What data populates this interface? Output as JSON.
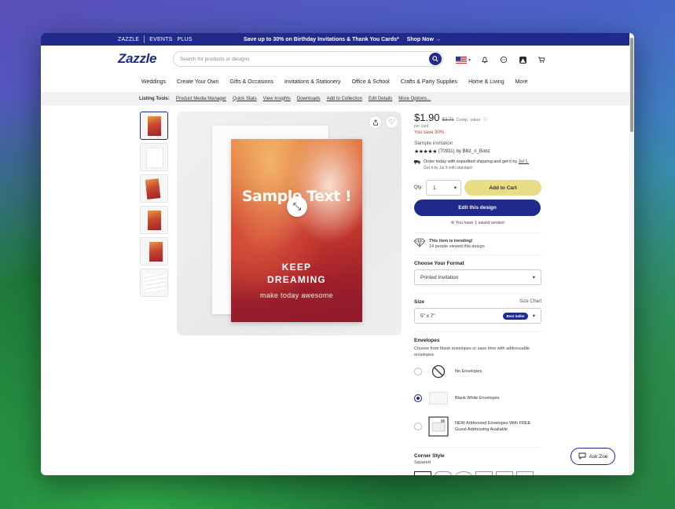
{
  "promo": {
    "links": [
      "ZAZZLE",
      "EVENTS",
      "PLUS"
    ],
    "message": "Save up to 30% on Birthday Invitations & Thank You Cards*",
    "cta": "Shop Now →"
  },
  "header": {
    "logo": "Zazzle",
    "search_placeholder": "Search for products or designs"
  },
  "nav": [
    "Weddings",
    "Create Your Own",
    "Gifts & Occasions",
    "Invitations & Stationery",
    "Office & School",
    "Crafts & Party Supplies",
    "Home & Living",
    "More"
  ],
  "tools": {
    "label": "Listing Tools:",
    "links": [
      "Product Media Manager",
      "Quick Stats",
      "View Insights",
      "Downloads",
      "Add to Collection",
      "Edit Details",
      "More Options..."
    ]
  },
  "card": {
    "title": "Sample Text !",
    "line1": "KEEP",
    "line2": "DREAMING",
    "line3": "make today awesome"
  },
  "product": {
    "price": "$1.90",
    "comp_price": "$2.71",
    "comp_label": "Comp. value",
    "per": "per card",
    "save": "You save 30%",
    "name": "Sample invitation",
    "stars": "★★★★★",
    "reviews": "(70931)",
    "by": "by Blitz_n_Bobz",
    "ship_line1": "Order today with expedited shipping and get it by",
    "ship_date": "Jul 1.",
    "ship_line2": "Get it by Jul 9 with standard",
    "qty_label": "Qty:",
    "qty": "1",
    "add_to_cart": "Add to Cart",
    "edit": "Edit this design",
    "saved": "You have 1 saved version",
    "trend_title": "This item is trending!",
    "trend_sub": "14 people viewed this design"
  },
  "options": {
    "format_title": "Choose Your Format",
    "format_value": "Printed Invitation",
    "size_title": "Size",
    "size_chart": "Size Chart",
    "size_value": "5\" x 7\"",
    "size_badge": "Best Seller",
    "env_title": "Envelopes",
    "env_sub": "Choose from blank envelopes or save time with addressable envelopes",
    "env_options": [
      "No Envelopes",
      "Blank White Envelopes",
      "NEW Addressed Envelopes With FREE Guest Addressing Available"
    ],
    "corner_title": "Corner Style",
    "corner_value": "Squared"
  },
  "ask": "Ask Zoe",
  "colors": {
    "brand": "#1f2a8a",
    "cart": "#e8dc86",
    "save": "#c0392b"
  }
}
